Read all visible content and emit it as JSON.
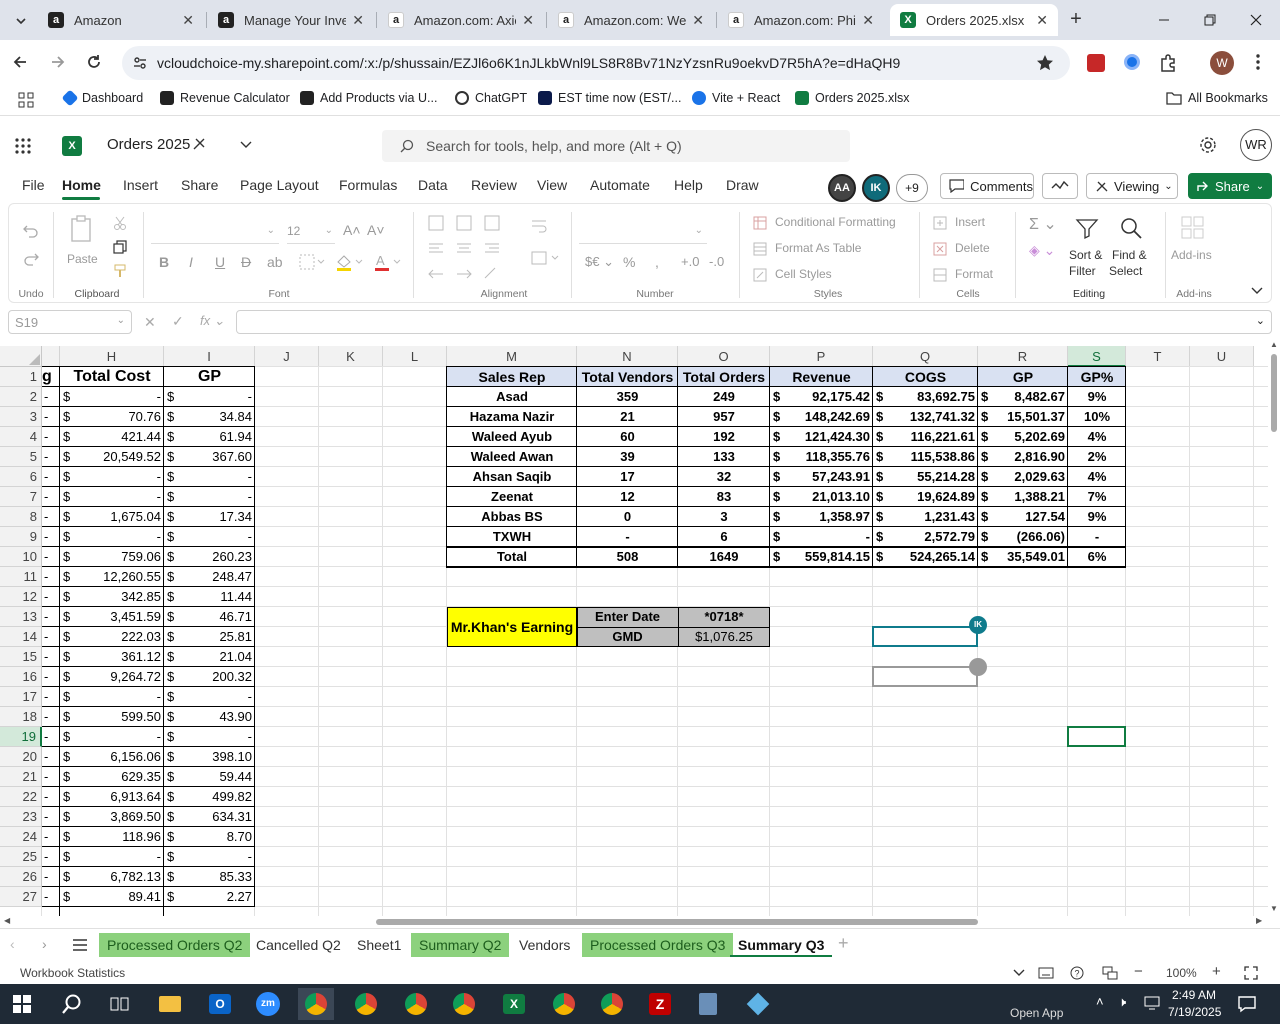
{
  "browser": {
    "tabs": [
      {
        "title": "Amazon",
        "fav": "a",
        "color": "#222"
      },
      {
        "title": "Manage Your Inve",
        "fav": "a",
        "color": "#222"
      },
      {
        "title": "Amazon.com: Axic",
        "fav": "a",
        "color": "#fff"
      },
      {
        "title": "Amazon.com: Wes",
        "fav": "a",
        "color": "#fff"
      },
      {
        "title": "Amazon.com: Phil",
        "fav": "a",
        "color": "#fff"
      },
      {
        "title": "Orders 2025.xlsx",
        "fav": "X",
        "color": "#107c41"
      }
    ],
    "url": "vcloudchoice-my.sharepoint.com/:x:/p/shussain/EZJl6o6K1nJLkbWnl9LS8R8Bv71NzYzsnRu9oekvD7R5hA?e=dHaQH9",
    "profile_initial": "W",
    "bookmarks": [
      "Dashboard",
      "Revenue Calculator",
      "Add Products via U...",
      "ChatGPT",
      "EST time now (EST/...",
      "Vite + React",
      "Orders 2025.xlsx"
    ],
    "all_bookmarks": "All Bookmarks"
  },
  "excel": {
    "doc_title": "Orders 2025",
    "search_placeholder": "Search for tools, help, and more (Alt + Q)",
    "user_initials": "WR",
    "menu": [
      "File",
      "Home",
      "Insert",
      "Share",
      "Page Layout",
      "Formulas",
      "Data",
      "Review",
      "View",
      "Automate",
      "Help",
      "Draw"
    ],
    "presence": {
      "a1": "AA",
      "a2": "IK",
      "more": "+9"
    },
    "comments_label": "Comments",
    "viewing_label": "Viewing",
    "share_label": "Share",
    "ribbon": {
      "undo": "Undo",
      "clipboard": "Clipboard",
      "paste": "Paste",
      "font": "Font",
      "font_size": "12",
      "alignment": "Alignment",
      "number": "Number",
      "styles": "Styles",
      "cond_format": "Conditional Formatting",
      "format_table": "Format As Table",
      "cell_styles": "Cell Styles",
      "cells": "Cells",
      "insert": "Insert",
      "delete": "Delete",
      "format": "Format",
      "editing": "Editing",
      "sort1": "Sort &",
      "sort2": "Filter",
      "find1": "Find &",
      "find2": "Select",
      "addins": "Add-ins",
      "addins2": "Add-ins"
    },
    "name_box": "S19"
  },
  "grid": {
    "columns": [
      "H",
      "I",
      "J",
      "K",
      "L",
      "M",
      "N",
      "O",
      "P",
      "Q",
      "R",
      "S",
      "T",
      "U"
    ],
    "rows": [
      "1",
      "2",
      "3",
      "4",
      "5",
      "6",
      "7",
      "8",
      "9",
      "10",
      "11",
      "12",
      "13",
      "14",
      "15",
      "16",
      "17",
      "18",
      "19",
      "20",
      "21",
      "22",
      "23",
      "24",
      "25",
      "26",
      "27"
    ],
    "left_header": {
      "g": "g",
      "total_cost": "Total Cost",
      "gp": "GP"
    },
    "left_values": [
      [
        "-",
        "-"
      ],
      [
        "70.76",
        "34.84"
      ],
      [
        "421.44",
        "61.94"
      ],
      [
        "20,549.52",
        "367.60"
      ],
      [
        "-",
        "-"
      ],
      [
        "-",
        "-"
      ],
      [
        "1,675.04",
        "17.34"
      ],
      [
        "-",
        "-"
      ],
      [
        "759.06",
        "260.23"
      ],
      [
        "12,260.55",
        "248.47"
      ],
      [
        "342.85",
        "11.44"
      ],
      [
        "3,451.59",
        "46.71"
      ],
      [
        "222.03",
        "25.81"
      ],
      [
        "361.12",
        "21.04"
      ],
      [
        "9,264.72",
        "200.32"
      ],
      [
        "-",
        "-"
      ],
      [
        "599.50",
        "43.90"
      ],
      [
        "-",
        "-"
      ],
      [
        "6,156.06",
        "398.10"
      ],
      [
        "629.35",
        "59.44"
      ],
      [
        "6,913.64",
        "499.82"
      ],
      [
        "3,869.50",
        "634.31"
      ],
      [
        "118.96",
        "8.70"
      ],
      [
        "-",
        "-"
      ],
      [
        "6,782.13",
        "85.33"
      ],
      [
        "89.41",
        "2.27"
      ]
    ],
    "dash": "-",
    "currency": "$",
    "summary": {
      "headers": [
        "Sales Rep",
        "Total Vendors",
        "Total Orders",
        "Revenue",
        "COGS",
        "GP",
        "GP%"
      ],
      "rows": [
        [
          "Asad",
          "359",
          "249",
          "92,175.42",
          "83,692.75",
          "8,482.67",
          "9%"
        ],
        [
          "Hazama Nazir",
          "21",
          "957",
          "148,242.69",
          "132,741.32",
          "15,501.37",
          "10%"
        ],
        [
          "Waleed Ayub",
          "60",
          "192",
          "121,424.30",
          "116,221.61",
          "5,202.69",
          "4%"
        ],
        [
          "Waleed Awan",
          "39",
          "133",
          "118,355.76",
          "115,538.86",
          "2,816.90",
          "2%"
        ],
        [
          "Ahsan Saqib",
          "17",
          "32",
          "57,243.91",
          "55,214.28",
          "2,029.63",
          "4%"
        ],
        [
          "Zeenat",
          "12",
          "83",
          "21,013.10",
          "19,624.89",
          "1,388.21",
          "7%"
        ],
        [
          "Abbas BS",
          "0",
          "3",
          "1,358.97",
          "1,231.43",
          "127.54",
          "9%"
        ],
        [
          "TXWH",
          "-",
          "6",
          "-",
          "2,572.79",
          "(266.06)",
          "-"
        ],
        [
          "Total",
          "508",
          "1649",
          "559,814.15",
          "524,265.14",
          "35,549.01",
          "6%"
        ]
      ]
    },
    "earning": {
      "label": "Mr.Khan's Earning",
      "enter_date": "Enter Date",
      "date_val": "*0718*",
      "gmd": "GMD",
      "gmd_val": "$1,076.25"
    },
    "cursor_tag": "IK"
  },
  "sheets": [
    {
      "name": "Processed Orders Q2",
      "style": "green"
    },
    {
      "name": "Cancelled Q2",
      "style": "plain"
    },
    {
      "name": "Sheet1",
      "style": "plain"
    },
    {
      "name": "Summary Q2",
      "style": "green"
    },
    {
      "name": "Vendors",
      "style": "plain"
    },
    {
      "name": "Processed Orders Q3",
      "style": "green"
    },
    {
      "name": "Summary Q3",
      "style": "active"
    }
  ],
  "status": {
    "left": "Workbook Statistics",
    "zoom": "100%"
  },
  "taskbar": {
    "open_app": "Open App",
    "time": "2:49 AM",
    "date": "7/19/2025"
  }
}
